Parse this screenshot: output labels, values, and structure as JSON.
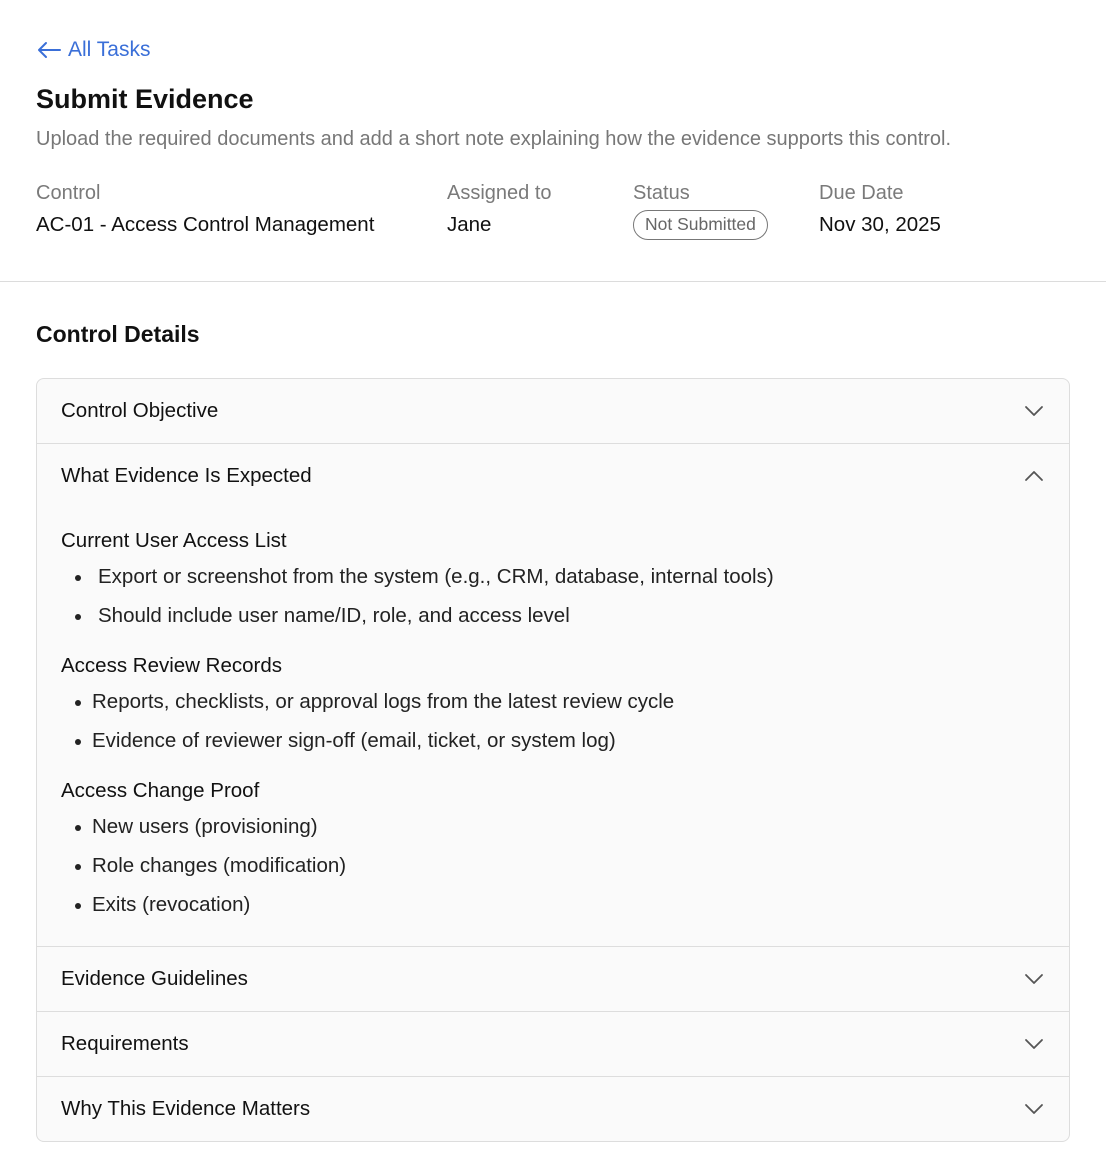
{
  "nav": {
    "back_label": "All Tasks"
  },
  "page": {
    "title": "Submit Evidence",
    "subtitle": "Upload the required documents and add a short note explaining how the evidence supports this control."
  },
  "meta": {
    "control": {
      "label": "Control",
      "value": "AC-01 - Access Control Management"
    },
    "assigned": {
      "label": "Assigned to",
      "value": "Jane"
    },
    "status": {
      "label": "Status",
      "value": "Not Submitted"
    },
    "due": {
      "label": "Due Date",
      "value": "Nov 30, 2025"
    }
  },
  "control_details": {
    "title": "Control Details",
    "sections": [
      {
        "title": "Control Objective",
        "expanded": false
      },
      {
        "title": "What Evidence Is Expected",
        "expanded": true,
        "groups": [
          {
            "title": "Current User Access List",
            "items": [
              "Export or screenshot from the system (e.g., CRM, database, internal tools)",
              "Should include user name/ID, role, and access level"
            ]
          },
          {
            "title": "Access Review Records",
            "items": [
              "Reports, checklists, or approval logs from the latest review cycle",
              "Evidence of reviewer sign-off (email, ticket, or system log)"
            ]
          },
          {
            "title": "Access Change Proof",
            "items": [
              "New users (provisioning)",
              "Role changes (modification)",
              "Exits (revocation)"
            ]
          }
        ]
      },
      {
        "title": "Evidence Guidelines",
        "expanded": false
      },
      {
        "title": "Requirements",
        "expanded": false
      },
      {
        "title": "Why This Evidence Matters",
        "expanded": false
      }
    ]
  },
  "colors": {
    "link": "#3a6fd8",
    "muted_text": "#777777",
    "border": "#dddddd"
  },
  "icons": {
    "back": "arrow-left-icon",
    "collapsed": "chevron-down-icon",
    "expanded": "chevron-up-icon"
  }
}
